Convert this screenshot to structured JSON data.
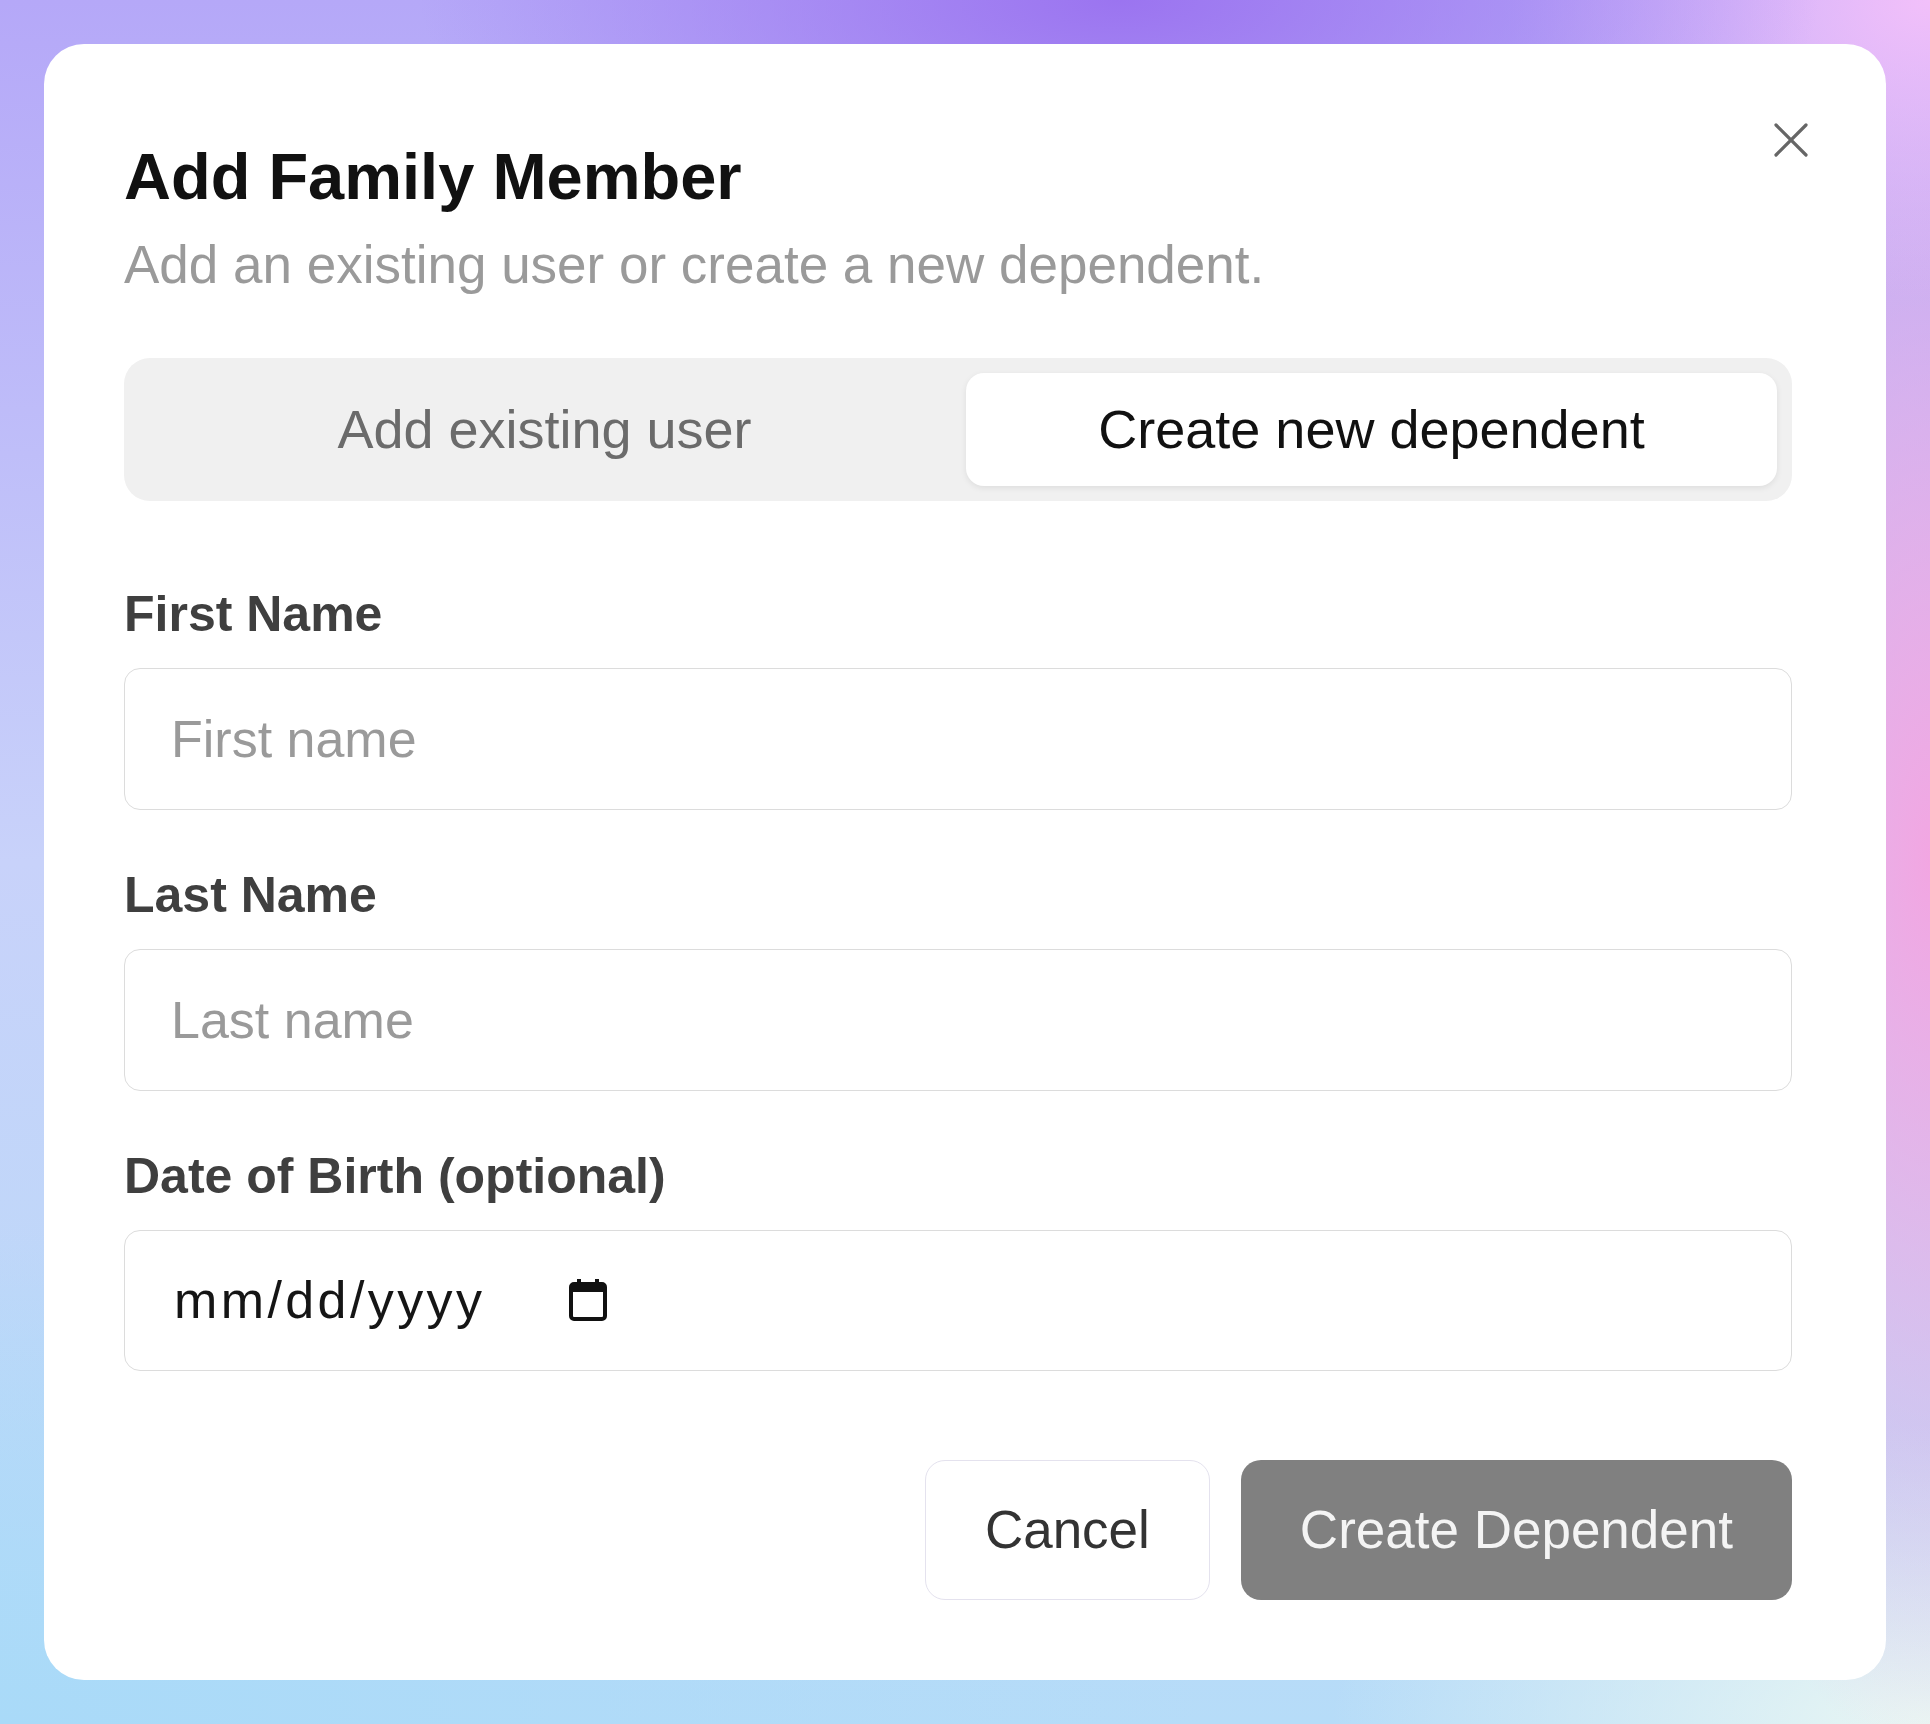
{
  "dialog": {
    "title": "Add Family Member",
    "subtitle": "Add an existing user or create a new dependent."
  },
  "tabs": [
    {
      "label": "Add existing user",
      "selected": false
    },
    {
      "label": "Create new dependent",
      "selected": true
    }
  ],
  "fields": [
    {
      "kind": "text",
      "label": "First Name",
      "placeholder": "First name"
    },
    {
      "kind": "text",
      "label": "Last Name",
      "placeholder": "Last name"
    },
    {
      "kind": "date",
      "label": "Date of Birth (optional)",
      "placeholder": "mm/dd/yyyy"
    }
  ],
  "buttons": [
    {
      "label": "Cancel",
      "kind": "secondary",
      "disabled": false
    },
    {
      "label": "Create Dependent",
      "kind": "primary",
      "disabled": true
    }
  ]
}
